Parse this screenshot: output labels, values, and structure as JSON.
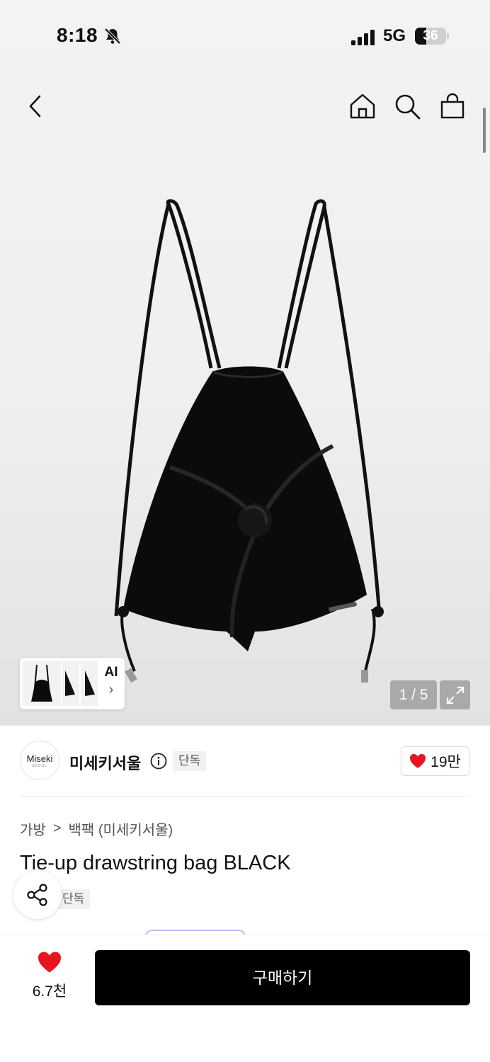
{
  "status_bar": {
    "time": "8:18",
    "network": "5G",
    "battery": "36",
    "battery_level": 0.36
  },
  "gallery": {
    "counter": "1 / 5",
    "ai_label": "AI",
    "image_alt": "Black drawstring backpack with tie-up knot"
  },
  "brand": {
    "logo_text": "Miseki",
    "logo_sub": "SEOUL",
    "name": "미세키서울",
    "tag": "단독",
    "likes": "19만"
  },
  "breadcrumb": {
    "category": "가방",
    "separator": ">",
    "subcategory": "백팩 (미세키서울)"
  },
  "product": {
    "title": "Tie-up drawstring bag BLACK",
    "tag": "단독"
  },
  "bottom_bar": {
    "wish_count": "6.7천",
    "buy_label": "구매하기"
  },
  "colors": {
    "heart": "#e8151f",
    "primary": "#000000"
  }
}
